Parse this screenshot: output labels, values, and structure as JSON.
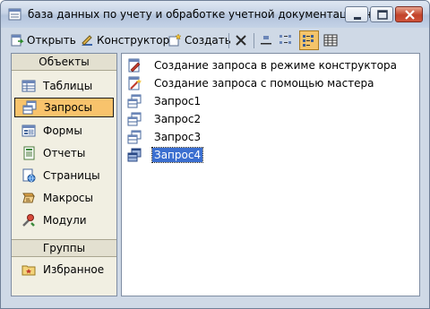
{
  "window": {
    "title": "база данных по учету и обработке учетной документации на ..."
  },
  "toolbar": {
    "open_label": "Открыть",
    "designer_label": "Конструктор",
    "create_label": "Создать"
  },
  "sidebar": {
    "objects_header": "Объекты",
    "groups_header": "Группы",
    "items": [
      {
        "label": "Таблицы",
        "icon": "table-icon"
      },
      {
        "label": "Запросы",
        "icon": "query-icon",
        "selected": true
      },
      {
        "label": "Формы",
        "icon": "form-icon"
      },
      {
        "label": "Отчеты",
        "icon": "report-icon"
      },
      {
        "label": "Страницы",
        "icon": "page-icon"
      },
      {
        "label": "Макросы",
        "icon": "macro-icon"
      },
      {
        "label": "Модули",
        "icon": "module-icon"
      }
    ],
    "favorites_label": "Избранное"
  },
  "main": {
    "items": [
      {
        "label": "Создание запроса в режиме конструктора",
        "icon": "create-query-icon"
      },
      {
        "label": "Создание запроса с помощью мастера",
        "icon": "wizard-query-icon"
      },
      {
        "label": "Запрос1",
        "icon": "query-icon"
      },
      {
        "label": "Запрос2",
        "icon": "query-icon"
      },
      {
        "label": "Запрос3",
        "icon": "query-icon"
      },
      {
        "label": "Запрос4",
        "icon": "query-icon",
        "selected": true
      }
    ]
  },
  "colors": {
    "selection_orange": "#f8c36c",
    "selection_blue": "#3b6fd0",
    "frame": "#cfd9e6"
  }
}
